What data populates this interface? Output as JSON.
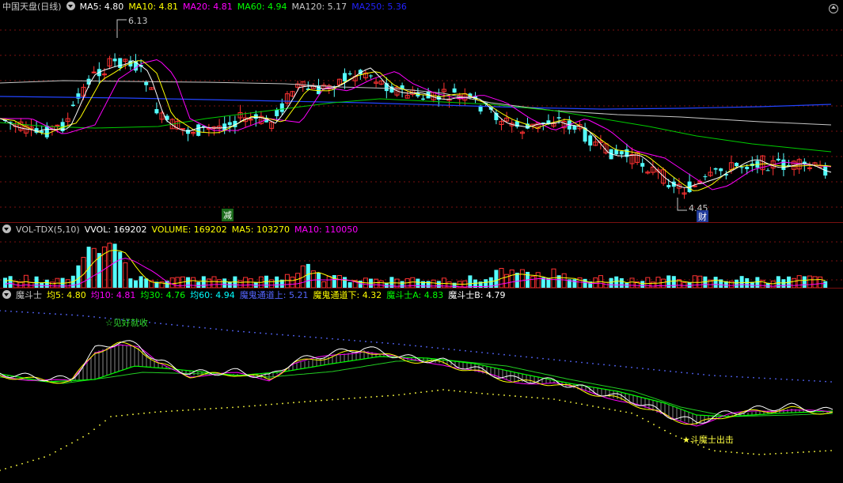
{
  "main": {
    "title": "中国天盘(日线)",
    "ma": [
      {
        "label": "MA5: 4.80",
        "color": "#ffffff"
      },
      {
        "label": "MA10: 4.81",
        "color": "#ffff00"
      },
      {
        "label": "MA20: 4.81",
        "color": "#ff00ff"
      },
      {
        "label": "MA60: 4.94",
        "color": "#00ff00"
      },
      {
        "label": "MA120: 5.17",
        "color": "#c8c8c8"
      },
      {
        "label": "MA250: 5.36",
        "color": "#2222ff"
      }
    ],
    "high_label": "6.13",
    "low_label": "4.45",
    "marker_jian": "减",
    "marker_cai": "财"
  },
  "volume": {
    "title": "VOL-TDX(5,10)",
    "items": [
      {
        "label": "VVOL: 169202",
        "color": "#ffffff"
      },
      {
        "label": "VOLUME: 169202",
        "color": "#ffff00"
      },
      {
        "label": "MA5: 103270",
        "color": "#ffff00"
      },
      {
        "label": "MA10: 110050",
        "color": "#ff00ff"
      }
    ]
  },
  "indicator": {
    "title": "魔斗士",
    "items": [
      {
        "label": "均5: 4.80",
        "color": "#ffff00"
      },
      {
        "label": "均10: 4.81",
        "color": "#ff00ff"
      },
      {
        "label": "均30: 4.76",
        "color": "#00ff00"
      },
      {
        "label": "均60: 4.94",
        "color": "#00ffff"
      },
      {
        "label": "魔鬼通道上: 5.21",
        "color": "#5566ff"
      },
      {
        "label": "魔鬼通道下: 4.32",
        "color": "#ffff00"
      },
      {
        "label": "魔斗士A: 4.83",
        "color": "#00ff00"
      },
      {
        "label": "魔斗士B: 4.79",
        "color": "#ffffff"
      }
    ],
    "note_top": "☆见好就收",
    "note_bottom": "★斗魔士出击"
  },
  "colors": {
    "up": "#ff3232",
    "down": "#54ffff",
    "grid": "#7a1010"
  }
}
